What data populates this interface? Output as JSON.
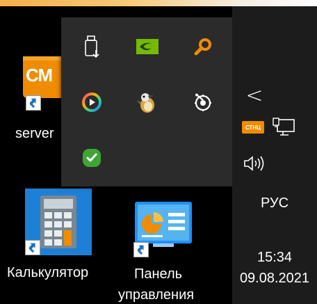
{
  "desktop": {
    "icons": [
      {
        "label": "server",
        "badge": "СМ"
      },
      {
        "label": "Калькулятор"
      },
      {
        "label_line1": "Панель",
        "label_line2": "управления"
      }
    ]
  },
  "tray_flyout": {
    "icons": [
      "usb-eject-icon",
      "nvidia-icon",
      "search-magnifier-icon",
      "media-player-icon",
      "bird-app-icon",
      "steelseries-icon",
      "checkmark-shield-icon"
    ]
  },
  "taskbar": {
    "chevron": "<",
    "sticky_badge": "СТНЦ",
    "language": "РУС",
    "time": "15:34",
    "date": "09.08.2021"
  },
  "colors": {
    "accent_orange": "#f08c00",
    "nvidia_green": "#76b900",
    "check_green": "#3fa535",
    "calc_blue": "#1e7fd6"
  }
}
